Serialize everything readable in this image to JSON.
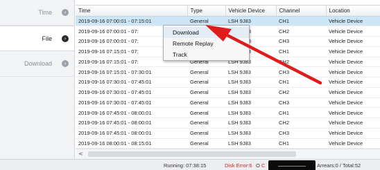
{
  "sidebar": {
    "items": [
      {
        "label": "Time",
        "icon": "chevron-right-circle-icon",
        "active": false
      },
      {
        "label": "File",
        "icon": "chevron-right-circle-icon",
        "active": true
      },
      {
        "label": "Download",
        "icon": "chevron-right-circle-icon",
        "active": false
      }
    ]
  },
  "table": {
    "columns": [
      "Time",
      "Type",
      "Vehicle Device",
      "Channel",
      "Location"
    ],
    "rows": [
      [
        "2019-09-16 07:00:01 - 07:15:01",
        "General",
        "LSH 9J83",
        "CH1",
        "Vehicle Device"
      ],
      [
        "2019-09-16 07:00:01 - 07:",
        "General",
        "LSH 9J83",
        "CH2",
        "Vehicle Device"
      ],
      [
        "2019-09-16 07:00:01 - 07:",
        "General",
        "LSH 9J83",
        "CH3",
        "Vehicle Device"
      ],
      [
        "2019-09-16 07:15:01 - 07:",
        "General",
        "LSH 9J83",
        "CH1",
        "Vehicle Device"
      ],
      [
        "2019-09-16 07:15:01 - 07:",
        "General",
        "LSH 9J83",
        "CH2",
        "Vehicle Device"
      ],
      [
        "2019-09-16 07:15:01 - 07:30:01",
        "General",
        "LSH 9J83",
        "CH3",
        "Vehicle Device"
      ],
      [
        "2019-09-16 07:30:01 - 07:45:01",
        "General",
        "LSH 9J83",
        "CH1",
        "Vehicle Device"
      ],
      [
        "2019-09-16 07:30:01 - 07:45:01",
        "General",
        "LSH 9J83",
        "CH2",
        "Vehicle Device"
      ],
      [
        "2019-09-16 07:30:01 - 07:45:01",
        "General",
        "LSH 9J83",
        "CH3",
        "Vehicle Device"
      ],
      [
        "2019-09-16 07:45:01 - 08:00:01",
        "General",
        "LSH 9J83",
        "CH1",
        "Vehicle Device"
      ],
      [
        "2019-09-16 07:45:01 - 08:00:01",
        "General",
        "LSH 9J83",
        "CH2",
        "Vehicle Device"
      ],
      [
        "2019-09-16 07:45:01 - 08:00:01",
        "General",
        "LSH 9J83",
        "CH3",
        "Vehicle Device"
      ],
      [
        "2019-09-16 08:00:01 - 08:15:01",
        "General",
        "LSH 9J83",
        "CH1",
        "Vehicle Device"
      ]
    ],
    "selected_row": 0
  },
  "context_menu": {
    "items": [
      {
        "label": "Download",
        "highlighted": true
      },
      {
        "label": "Remote Replay",
        "highlighted": false
      },
      {
        "label": "Track",
        "highlighted": false
      }
    ]
  },
  "scrollbar": {
    "left_arrow": "<"
  },
  "statusbar": {
    "running": "Running: 07:38:15",
    "disk_error": "Disk Error:6",
    "o_label": "O",
    "o_error": "C",
    "arrears": "Arrears:0 / Total:52"
  },
  "colors": {
    "selection": "#cde6f7",
    "error": "#d42020",
    "annotation_arrow": "#e01b1b"
  }
}
